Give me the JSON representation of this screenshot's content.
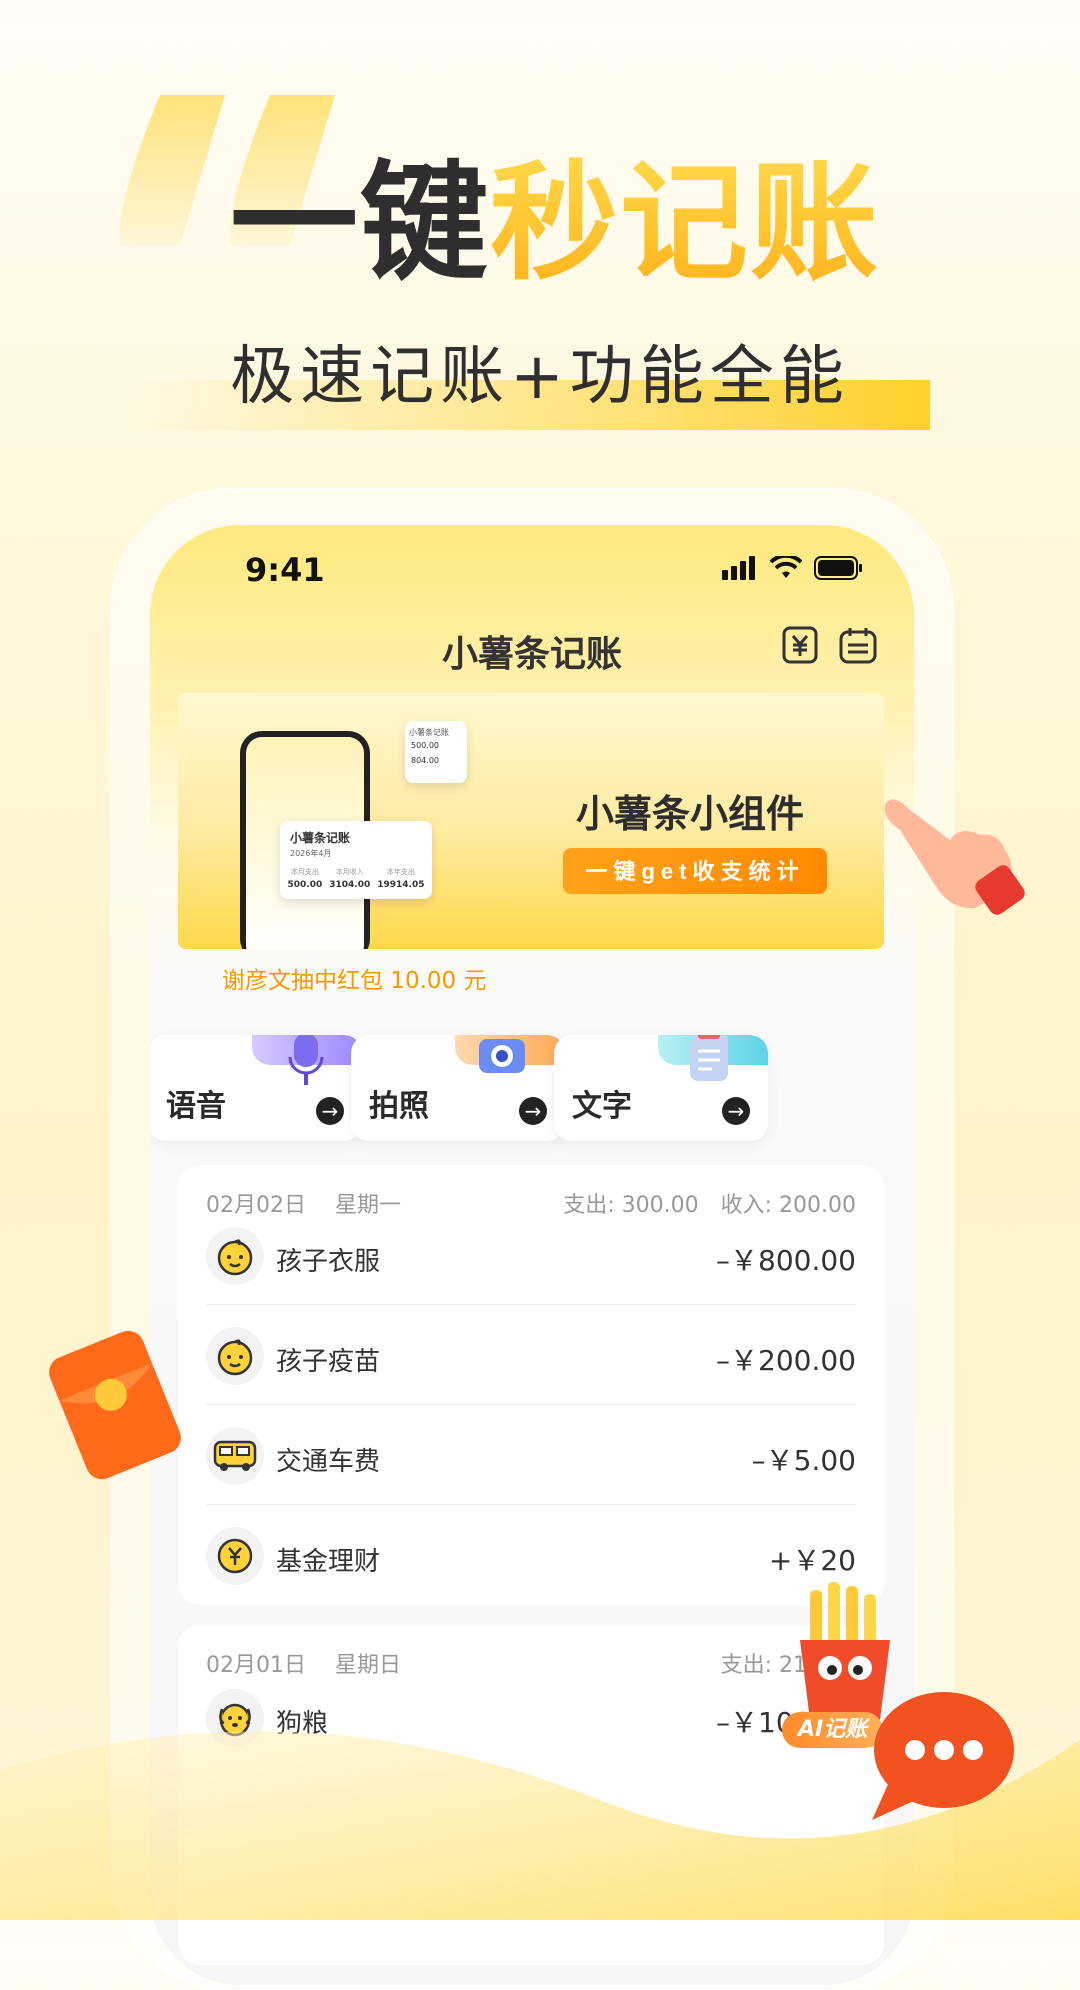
{
  "hero": {
    "title_dark": "一键",
    "title_accent": "秒记账",
    "subtitle": "极速记账+功能全能"
  },
  "status_bar": {
    "time": "9:41"
  },
  "app": {
    "title": "小薯条记账",
    "icons": [
      "yuan-icon",
      "calendar-icon"
    ]
  },
  "banner": {
    "title": "小薯条小组件",
    "button": "一键get收支统计",
    "mini_card": {
      "title": "小薯条记账",
      "date": "2026年4月",
      "stats": [
        {
          "label": "本月支出",
          "value": "500.00"
        },
        {
          "label": "本月收入",
          "value": "3104.00"
        },
        {
          "label": "本年支出",
          "value": "19914.05"
        }
      ]
    },
    "mini_card2": {
      "v1": "500.00",
      "v2": "804.00"
    }
  },
  "notice": "谢彦文抽中红包 10.00 元",
  "entries": [
    {
      "label": "语音",
      "icon": "microphone-icon"
    },
    {
      "label": "拍照",
      "icon": "camera-icon"
    },
    {
      "label": "文字",
      "icon": "notepad-icon"
    }
  ],
  "days": [
    {
      "date": "02月02日",
      "weekday": "星期一",
      "summary": "支出: 300.00　收入: 200.00",
      "items": [
        {
          "name": "孩子衣服",
          "amount": "–￥800.00",
          "icon": "baby-face-icon"
        },
        {
          "name": "孩子疫苗",
          "amount": "–￥200.00",
          "icon": "baby-face-icon"
        },
        {
          "name": "交通车费",
          "amount": "–￥5.00",
          "icon": "bus-icon"
        },
        {
          "name": "基金理财",
          "amount": "+￥20",
          "icon": "yuan-coin-icon"
        }
      ]
    },
    {
      "date": "02月01日",
      "weekday": "星期日",
      "summary": "支出: 210.00",
      "items": [
        {
          "name": "狗粮",
          "amount": "–￥100.00",
          "icon": "dog-icon"
        }
      ]
    }
  ],
  "ai_badge": "AI记账",
  "colors": {
    "accent": "#ffb21c",
    "orange": "#ff8a00",
    "text": "#333333"
  }
}
